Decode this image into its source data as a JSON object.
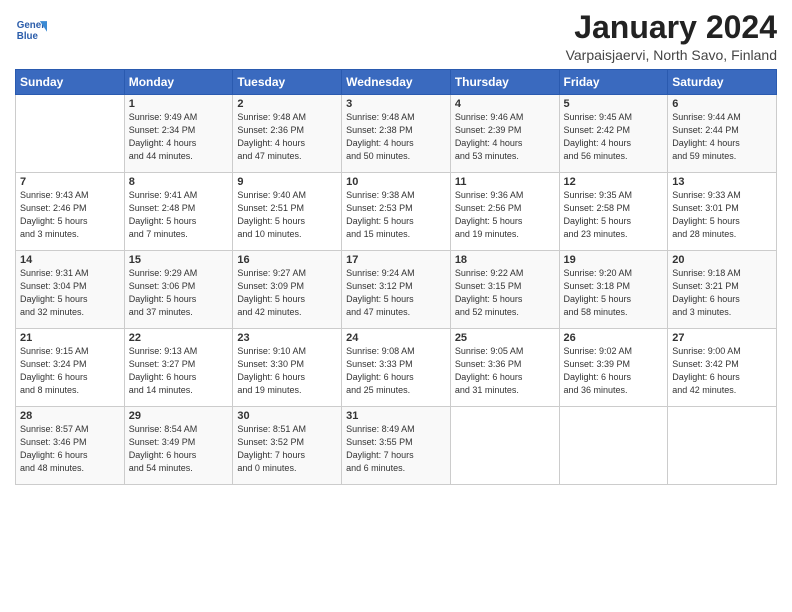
{
  "header": {
    "logo_line1": "General",
    "logo_line2": "Blue",
    "month": "January 2024",
    "location": "Varpaisjaervi, North Savo, Finland"
  },
  "days_of_week": [
    "Sunday",
    "Monday",
    "Tuesday",
    "Wednesday",
    "Thursday",
    "Friday",
    "Saturday"
  ],
  "weeks": [
    [
      {
        "num": "",
        "info": ""
      },
      {
        "num": "1",
        "info": "Sunrise: 9:49 AM\nSunset: 2:34 PM\nDaylight: 4 hours\nand 44 minutes."
      },
      {
        "num": "2",
        "info": "Sunrise: 9:48 AM\nSunset: 2:36 PM\nDaylight: 4 hours\nand 47 minutes."
      },
      {
        "num": "3",
        "info": "Sunrise: 9:48 AM\nSunset: 2:38 PM\nDaylight: 4 hours\nand 50 minutes."
      },
      {
        "num": "4",
        "info": "Sunrise: 9:46 AM\nSunset: 2:39 PM\nDaylight: 4 hours\nand 53 minutes."
      },
      {
        "num": "5",
        "info": "Sunrise: 9:45 AM\nSunset: 2:42 PM\nDaylight: 4 hours\nand 56 minutes."
      },
      {
        "num": "6",
        "info": "Sunrise: 9:44 AM\nSunset: 2:44 PM\nDaylight: 4 hours\nand 59 minutes."
      }
    ],
    [
      {
        "num": "7",
        "info": "Sunrise: 9:43 AM\nSunset: 2:46 PM\nDaylight: 5 hours\nand 3 minutes."
      },
      {
        "num": "8",
        "info": "Sunrise: 9:41 AM\nSunset: 2:48 PM\nDaylight: 5 hours\nand 7 minutes."
      },
      {
        "num": "9",
        "info": "Sunrise: 9:40 AM\nSunset: 2:51 PM\nDaylight: 5 hours\nand 10 minutes."
      },
      {
        "num": "10",
        "info": "Sunrise: 9:38 AM\nSunset: 2:53 PM\nDaylight: 5 hours\nand 15 minutes."
      },
      {
        "num": "11",
        "info": "Sunrise: 9:36 AM\nSunset: 2:56 PM\nDaylight: 5 hours\nand 19 minutes."
      },
      {
        "num": "12",
        "info": "Sunrise: 9:35 AM\nSunset: 2:58 PM\nDaylight: 5 hours\nand 23 minutes."
      },
      {
        "num": "13",
        "info": "Sunrise: 9:33 AM\nSunset: 3:01 PM\nDaylight: 5 hours\nand 28 minutes."
      }
    ],
    [
      {
        "num": "14",
        "info": "Sunrise: 9:31 AM\nSunset: 3:04 PM\nDaylight: 5 hours\nand 32 minutes."
      },
      {
        "num": "15",
        "info": "Sunrise: 9:29 AM\nSunset: 3:06 PM\nDaylight: 5 hours\nand 37 minutes."
      },
      {
        "num": "16",
        "info": "Sunrise: 9:27 AM\nSunset: 3:09 PM\nDaylight: 5 hours\nand 42 minutes."
      },
      {
        "num": "17",
        "info": "Sunrise: 9:24 AM\nSunset: 3:12 PM\nDaylight: 5 hours\nand 47 minutes."
      },
      {
        "num": "18",
        "info": "Sunrise: 9:22 AM\nSunset: 3:15 PM\nDaylight: 5 hours\nand 52 minutes."
      },
      {
        "num": "19",
        "info": "Sunrise: 9:20 AM\nSunset: 3:18 PM\nDaylight: 5 hours\nand 58 minutes."
      },
      {
        "num": "20",
        "info": "Sunrise: 9:18 AM\nSunset: 3:21 PM\nDaylight: 6 hours\nand 3 minutes."
      }
    ],
    [
      {
        "num": "21",
        "info": "Sunrise: 9:15 AM\nSunset: 3:24 PM\nDaylight: 6 hours\nand 8 minutes."
      },
      {
        "num": "22",
        "info": "Sunrise: 9:13 AM\nSunset: 3:27 PM\nDaylight: 6 hours\nand 14 minutes."
      },
      {
        "num": "23",
        "info": "Sunrise: 9:10 AM\nSunset: 3:30 PM\nDaylight: 6 hours\nand 19 minutes."
      },
      {
        "num": "24",
        "info": "Sunrise: 9:08 AM\nSunset: 3:33 PM\nDaylight: 6 hours\nand 25 minutes."
      },
      {
        "num": "25",
        "info": "Sunrise: 9:05 AM\nSunset: 3:36 PM\nDaylight: 6 hours\nand 31 minutes."
      },
      {
        "num": "26",
        "info": "Sunrise: 9:02 AM\nSunset: 3:39 PM\nDaylight: 6 hours\nand 36 minutes."
      },
      {
        "num": "27",
        "info": "Sunrise: 9:00 AM\nSunset: 3:42 PM\nDaylight: 6 hours\nand 42 minutes."
      }
    ],
    [
      {
        "num": "28",
        "info": "Sunrise: 8:57 AM\nSunset: 3:46 PM\nDaylight: 6 hours\nand 48 minutes."
      },
      {
        "num": "29",
        "info": "Sunrise: 8:54 AM\nSunset: 3:49 PM\nDaylight: 6 hours\nand 54 minutes."
      },
      {
        "num": "30",
        "info": "Sunrise: 8:51 AM\nSunset: 3:52 PM\nDaylight: 7 hours\nand 0 minutes."
      },
      {
        "num": "31",
        "info": "Sunrise: 8:49 AM\nSunset: 3:55 PM\nDaylight: 7 hours\nand 6 minutes."
      },
      {
        "num": "",
        "info": ""
      },
      {
        "num": "",
        "info": ""
      },
      {
        "num": "",
        "info": ""
      }
    ]
  ]
}
